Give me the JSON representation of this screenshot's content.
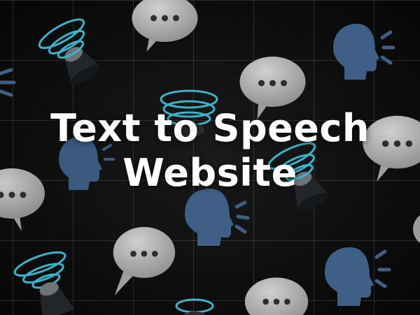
{
  "title": {
    "line1": "Text to Speech",
    "line2": "Website"
  },
  "colors": {
    "background": "#0b0b0b",
    "grid": "#ffffff",
    "bubble": "#bdbdbd",
    "bubble_dots": "#2e2e2e",
    "head": "#3f5f86",
    "speaker": "#555b60",
    "sound_rings": "#3bb3c8",
    "title": "#ffffff"
  },
  "icons": [
    "speech-bubble-icon",
    "speaking-head-icon",
    "speaker-icon"
  ]
}
